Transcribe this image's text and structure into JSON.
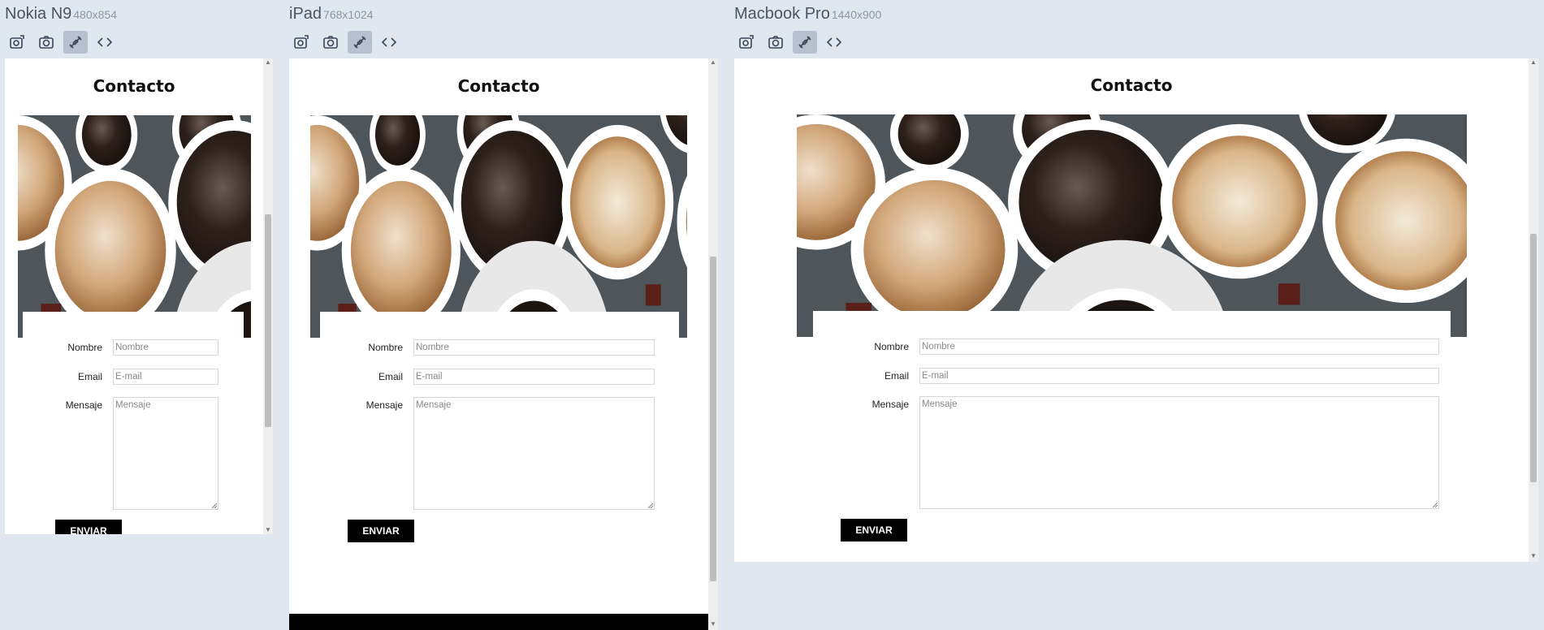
{
  "devices": [
    {
      "name": "Nokia N9",
      "size": "480x854"
    },
    {
      "name": "iPad",
      "size": "768x1024"
    },
    {
      "name": "Macbook Pro",
      "size": "1440x900"
    }
  ],
  "toolbar": {
    "icons": [
      "rotate-camera-icon",
      "screenshot-icon",
      "sync-icon",
      "code-icon"
    ]
  },
  "page": {
    "title": "Contacto",
    "form": {
      "name_label": "Nombre",
      "name_placeholder": "Nombre",
      "email_label": "Email",
      "email_placeholder": "E-mail",
      "message_label": "Mensaje",
      "message_placeholder": "Mensaje",
      "submit_label": "ENVIAR"
    }
  },
  "colors": {
    "background": "#e1e7ef",
    "active_tool": "#b6c0ce",
    "button": "#000000"
  }
}
